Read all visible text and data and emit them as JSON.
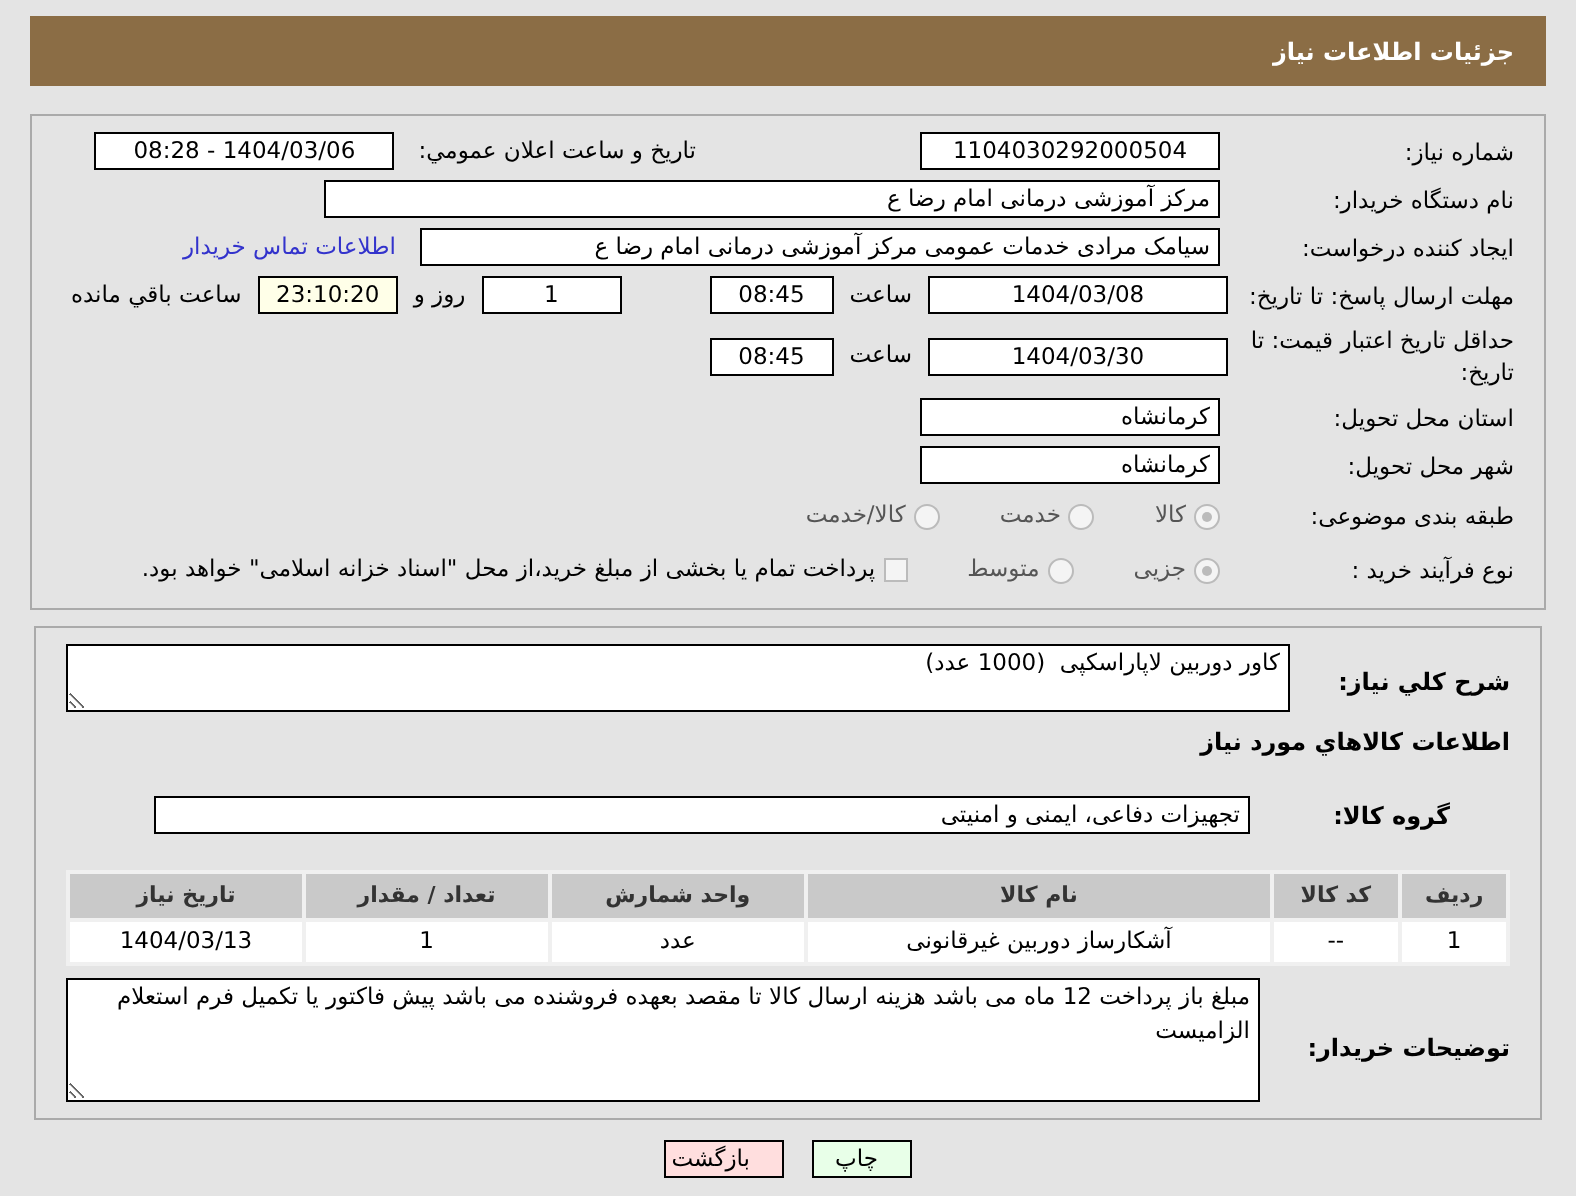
{
  "header": {
    "title": "جزئیات اطلاعات نیاز"
  },
  "need_number": {
    "label": "شماره نیاز:",
    "value": "1104030292000504"
  },
  "announce": {
    "label": "تاریخ و ساعت اعلان عمومي:",
    "value": "1404/03/06 - 08:28"
  },
  "buyer_org": {
    "label": "نام دستگاه خریدار:",
    "value": "مرکز آموزشی  درمانی امام رضا  ع"
  },
  "requester": {
    "label": "ایجاد کننده درخواست:",
    "value": "سیامک مرادی خدمات عمومی مرکز آموزشی  درمانی امام رضا  ع",
    "link": "اطلاعات تماس خریدار"
  },
  "deadline": {
    "label": "مهلت ارسال پاسخ: تا تاریخ:",
    "date": "1404/03/08",
    "time_label": "ساعت",
    "time": "08:45",
    "days": "1",
    "days_label": "روز و",
    "remaining": "23:10:20",
    "remaining_label": "ساعت باقي مانده"
  },
  "validity": {
    "label": "حداقل تاریخ اعتبار قیمت: تا تاریخ:",
    "date": "1404/03/30",
    "time_label": "ساعت",
    "time": "08:45"
  },
  "province": {
    "label": "استان محل تحویل:",
    "value": "کرمانشاه"
  },
  "city": {
    "label": "شهر محل تحویل:",
    "value": "کرمانشاه"
  },
  "category": {
    "label": "طبقه بندی موضوعی:",
    "options": [
      {
        "label": "کالا",
        "selected": true
      },
      {
        "label": "خدمت",
        "selected": false
      },
      {
        "label": "کالا/خدمت",
        "selected": false
      }
    ]
  },
  "purchase_type": {
    "label": "نوع فرآیند خرید :",
    "options": [
      {
        "label": "جزیی",
        "selected": true
      },
      {
        "label": "متوسط",
        "selected": false
      }
    ],
    "payment": {
      "label": "پرداخت تمام یا بخشی از مبلغ خرید،از محل \"اسناد خزانه اسلامی\" خواهد بود.",
      "checked": false
    }
  },
  "description": {
    "label": "شرح کلي نیاز:",
    "value": "کاور دوربین لاپاراسکپی  (1000 عدد)"
  },
  "goods": {
    "title": "اطلاعات کالاهاي مورد نیاز",
    "group_label": "گروه کالا:",
    "group_value": "تجهیزات دفاعی، ایمنی و امنیتی",
    "columns": [
      "ردیف",
      "کد کالا",
      "نام کالا",
      "واحد شمارش",
      "تعداد / مقدار",
      "تاریخ نیاز"
    ],
    "rows": [
      [
        "1",
        "--",
        "آشکارساز دوربین غیرقانونی",
        "عدد",
        "1",
        "1404/03/13"
      ]
    ]
  },
  "buyer_notes": {
    "label": "توضیحات خریدار:",
    "value": "مبلغ باز پرداخت 12 ماه می باشد هزینه ارسال کالا تا مقصد بعهده فروشنده می باشد پیش فاکتور یا تکمیل فرم استعلام الزامیست"
  },
  "buttons": [
    {
      "label": "چاپ",
      "kind": "print"
    },
    {
      "label": "بازگشت",
      "kind": "back"
    }
  ]
}
